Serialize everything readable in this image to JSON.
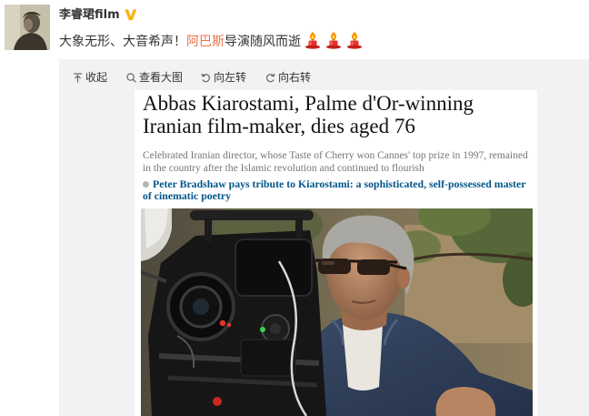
{
  "post": {
    "author": {
      "name": "李睿珺film",
      "verified_badge": "V"
    },
    "text": {
      "before_link": "大象无形、大音希声！",
      "link": "阿巴斯",
      "after_link": "导演随风而逝"
    },
    "emoji": [
      "candle-icon",
      "candle-icon",
      "candle-icon"
    ]
  },
  "media_toolbar": {
    "items": [
      {
        "label": "收起",
        "icon": "collapse-icon"
      },
      {
        "label": "查看大图",
        "icon": "search-icon"
      },
      {
        "label": "向左转",
        "icon": "rotate-left-icon"
      },
      {
        "label": "向右转",
        "icon": "rotate-right-icon"
      }
    ]
  },
  "attached_image": {
    "headline_lines": [
      "Abbas Kiarostami, Palme d'Or-winning",
      "Iranian film-maker, dies aged 76"
    ],
    "standfirst_lines": [
      "Celebrated Iranian director, whose Taste of Cherry won Cannes' top prize in 1997, remained",
      "in the country after the Islamic revolution and continued to flourish"
    ],
    "related_link_lines": [
      "Peter Bradshaw pays tribute to Kiarostami: a sophisticated, self-possessed master",
      "of cinematic poetry"
    ]
  },
  "colors": {
    "post_link": "#eb7350",
    "verified_badge": "#f7b500",
    "panel_background": "#f2f2f5",
    "article_link": "#005689",
    "article_standfirst": "#767676"
  }
}
